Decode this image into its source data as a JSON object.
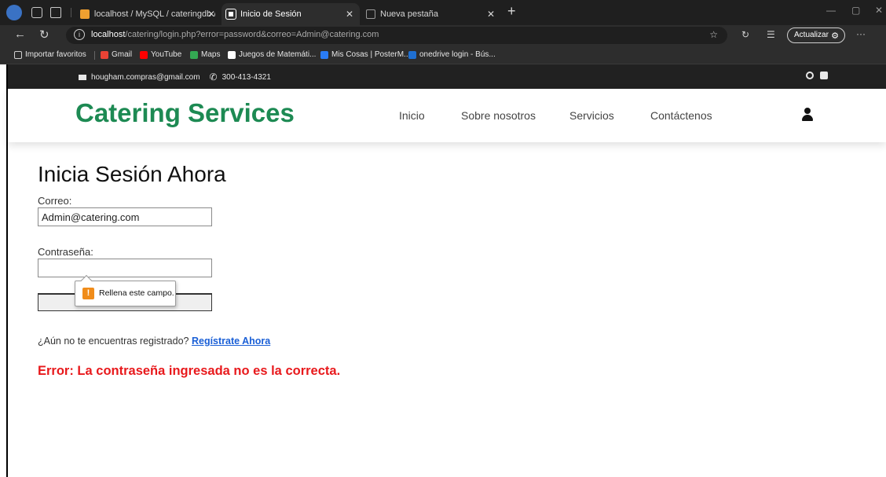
{
  "browser": {
    "tabs": [
      {
        "title": "localhost / MySQL / cateringdb /",
        "active": false
      },
      {
        "title": "Inicio de Sesión",
        "active": true
      },
      {
        "title": "Nueva pestaña",
        "active": false
      }
    ],
    "url_host": "localhost",
    "url_rest": "/catering/login.php?error=password&correo=Admin@catering.com",
    "update_label": "Actualizar",
    "bookmarks": [
      {
        "label": "Importar favoritos",
        "color": "#cfcfcf"
      },
      {
        "label": "Gmail",
        "color": "#ea4335"
      },
      {
        "label": "YouTube",
        "color": "#ff0000"
      },
      {
        "label": "Maps",
        "color": "#34a853"
      },
      {
        "label": "Juegos de Matemáti...",
        "color": "#ffffff"
      },
      {
        "label": "Mis Cosas | PosterM...",
        "color": "#2a7cf5"
      },
      {
        "label": "onedrive login - Bús...",
        "color": "#1f6fd1"
      }
    ]
  },
  "page": {
    "topbar": {
      "email": "hougham.compras@gmail.com",
      "phone": "300-413-4321"
    },
    "brand": "Catering Services",
    "nav": [
      "Inicio",
      "Sobre nosotros",
      "Servicios",
      "Contáctenos"
    ],
    "login": {
      "title": "Inicia Sesión Ahora",
      "email_label": "Correo:",
      "email_value": "Admin@catering.com",
      "password_label": "Contraseña:",
      "password_value": "",
      "tooltip": "Rellena este campo.",
      "register_prompt": "¿Aún no te encuentras registrado?",
      "register_link": "Regístrate Ahora",
      "error": "Error: La contraseña ingresada no es la correcta."
    },
    "colors": {
      "brand": "#1d8a53",
      "error": "#e8191c",
      "link": "#1a5fd6"
    }
  }
}
